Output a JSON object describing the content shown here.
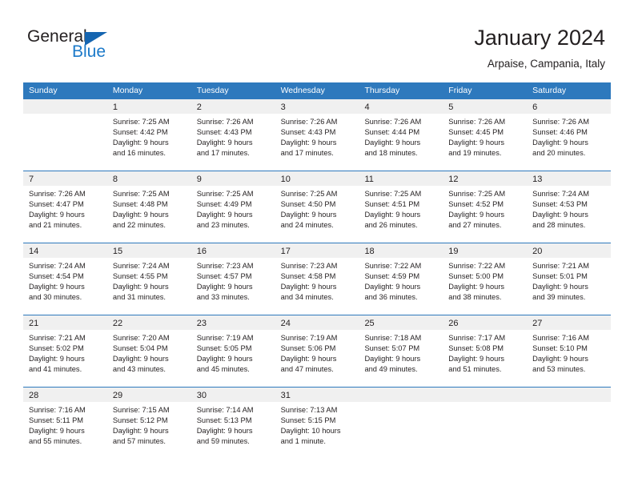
{
  "logo": {
    "word_one": "General",
    "word_two": "Blue",
    "triangle_icon": "blue-triangle-icon",
    "brand_color": "#1b79c9",
    "dark_color": "#231f20"
  },
  "header": {
    "title": "January 2024",
    "subtitle": "Arpaise, Campania, Italy"
  },
  "theme": {
    "header_blue": "#2e79bd",
    "daynum_band": "#f0f0f0",
    "text": "#231f20"
  },
  "calendar": {
    "day_headers": [
      "Sunday",
      "Monday",
      "Tuesday",
      "Wednesday",
      "Thursday",
      "Friday",
      "Saturday"
    ],
    "weeks": [
      [
        {
          "day": "",
          "lines": []
        },
        {
          "day": "1",
          "lines": [
            "Sunrise: 7:25 AM",
            "Sunset: 4:42 PM",
            "Daylight: 9 hours",
            "and 16 minutes."
          ]
        },
        {
          "day": "2",
          "lines": [
            "Sunrise: 7:26 AM",
            "Sunset: 4:43 PM",
            "Daylight: 9 hours",
            "and 17 minutes."
          ]
        },
        {
          "day": "3",
          "lines": [
            "Sunrise: 7:26 AM",
            "Sunset: 4:43 PM",
            "Daylight: 9 hours",
            "and 17 minutes."
          ]
        },
        {
          "day": "4",
          "lines": [
            "Sunrise: 7:26 AM",
            "Sunset: 4:44 PM",
            "Daylight: 9 hours",
            "and 18 minutes."
          ]
        },
        {
          "day": "5",
          "lines": [
            "Sunrise: 7:26 AM",
            "Sunset: 4:45 PM",
            "Daylight: 9 hours",
            "and 19 minutes."
          ]
        },
        {
          "day": "6",
          "lines": [
            "Sunrise: 7:26 AM",
            "Sunset: 4:46 PM",
            "Daylight: 9 hours",
            "and 20 minutes."
          ]
        }
      ],
      [
        {
          "day": "7",
          "lines": [
            "Sunrise: 7:26 AM",
            "Sunset: 4:47 PM",
            "Daylight: 9 hours",
            "and 21 minutes."
          ]
        },
        {
          "day": "8",
          "lines": [
            "Sunrise: 7:25 AM",
            "Sunset: 4:48 PM",
            "Daylight: 9 hours",
            "and 22 minutes."
          ]
        },
        {
          "day": "9",
          "lines": [
            "Sunrise: 7:25 AM",
            "Sunset: 4:49 PM",
            "Daylight: 9 hours",
            "and 23 minutes."
          ]
        },
        {
          "day": "10",
          "lines": [
            "Sunrise: 7:25 AM",
            "Sunset: 4:50 PM",
            "Daylight: 9 hours",
            "and 24 minutes."
          ]
        },
        {
          "day": "11",
          "lines": [
            "Sunrise: 7:25 AM",
            "Sunset: 4:51 PM",
            "Daylight: 9 hours",
            "and 26 minutes."
          ]
        },
        {
          "day": "12",
          "lines": [
            "Sunrise: 7:25 AM",
            "Sunset: 4:52 PM",
            "Daylight: 9 hours",
            "and 27 minutes."
          ]
        },
        {
          "day": "13",
          "lines": [
            "Sunrise: 7:24 AM",
            "Sunset: 4:53 PM",
            "Daylight: 9 hours",
            "and 28 minutes."
          ]
        }
      ],
      [
        {
          "day": "14",
          "lines": [
            "Sunrise: 7:24 AM",
            "Sunset: 4:54 PM",
            "Daylight: 9 hours",
            "and 30 minutes."
          ]
        },
        {
          "day": "15",
          "lines": [
            "Sunrise: 7:24 AM",
            "Sunset: 4:55 PM",
            "Daylight: 9 hours",
            "and 31 minutes."
          ]
        },
        {
          "day": "16",
          "lines": [
            "Sunrise: 7:23 AM",
            "Sunset: 4:57 PM",
            "Daylight: 9 hours",
            "and 33 minutes."
          ]
        },
        {
          "day": "17",
          "lines": [
            "Sunrise: 7:23 AM",
            "Sunset: 4:58 PM",
            "Daylight: 9 hours",
            "and 34 minutes."
          ]
        },
        {
          "day": "18",
          "lines": [
            "Sunrise: 7:22 AM",
            "Sunset: 4:59 PM",
            "Daylight: 9 hours",
            "and 36 minutes."
          ]
        },
        {
          "day": "19",
          "lines": [
            "Sunrise: 7:22 AM",
            "Sunset: 5:00 PM",
            "Daylight: 9 hours",
            "and 38 minutes."
          ]
        },
        {
          "day": "20",
          "lines": [
            "Sunrise: 7:21 AM",
            "Sunset: 5:01 PM",
            "Daylight: 9 hours",
            "and 39 minutes."
          ]
        }
      ],
      [
        {
          "day": "21",
          "lines": [
            "Sunrise: 7:21 AM",
            "Sunset: 5:02 PM",
            "Daylight: 9 hours",
            "and 41 minutes."
          ]
        },
        {
          "day": "22",
          "lines": [
            "Sunrise: 7:20 AM",
            "Sunset: 5:04 PM",
            "Daylight: 9 hours",
            "and 43 minutes."
          ]
        },
        {
          "day": "23",
          "lines": [
            "Sunrise: 7:19 AM",
            "Sunset: 5:05 PM",
            "Daylight: 9 hours",
            "and 45 minutes."
          ]
        },
        {
          "day": "24",
          "lines": [
            "Sunrise: 7:19 AM",
            "Sunset: 5:06 PM",
            "Daylight: 9 hours",
            "and 47 minutes."
          ]
        },
        {
          "day": "25",
          "lines": [
            "Sunrise: 7:18 AM",
            "Sunset: 5:07 PM",
            "Daylight: 9 hours",
            "and 49 minutes."
          ]
        },
        {
          "day": "26",
          "lines": [
            "Sunrise: 7:17 AM",
            "Sunset: 5:08 PM",
            "Daylight: 9 hours",
            "and 51 minutes."
          ]
        },
        {
          "day": "27",
          "lines": [
            "Sunrise: 7:16 AM",
            "Sunset: 5:10 PM",
            "Daylight: 9 hours",
            "and 53 minutes."
          ]
        }
      ],
      [
        {
          "day": "28",
          "lines": [
            "Sunrise: 7:16 AM",
            "Sunset: 5:11 PM",
            "Daylight: 9 hours",
            "and 55 minutes."
          ]
        },
        {
          "day": "29",
          "lines": [
            "Sunrise: 7:15 AM",
            "Sunset: 5:12 PM",
            "Daylight: 9 hours",
            "and 57 minutes."
          ]
        },
        {
          "day": "30",
          "lines": [
            "Sunrise: 7:14 AM",
            "Sunset: 5:13 PM",
            "Daylight: 9 hours",
            "and 59 minutes."
          ]
        },
        {
          "day": "31",
          "lines": [
            "Sunrise: 7:13 AM",
            "Sunset: 5:15 PM",
            "Daylight: 10 hours",
            "and 1 minute."
          ]
        },
        {
          "day": "",
          "lines": []
        },
        {
          "day": "",
          "lines": []
        },
        {
          "day": "",
          "lines": []
        }
      ]
    ]
  }
}
